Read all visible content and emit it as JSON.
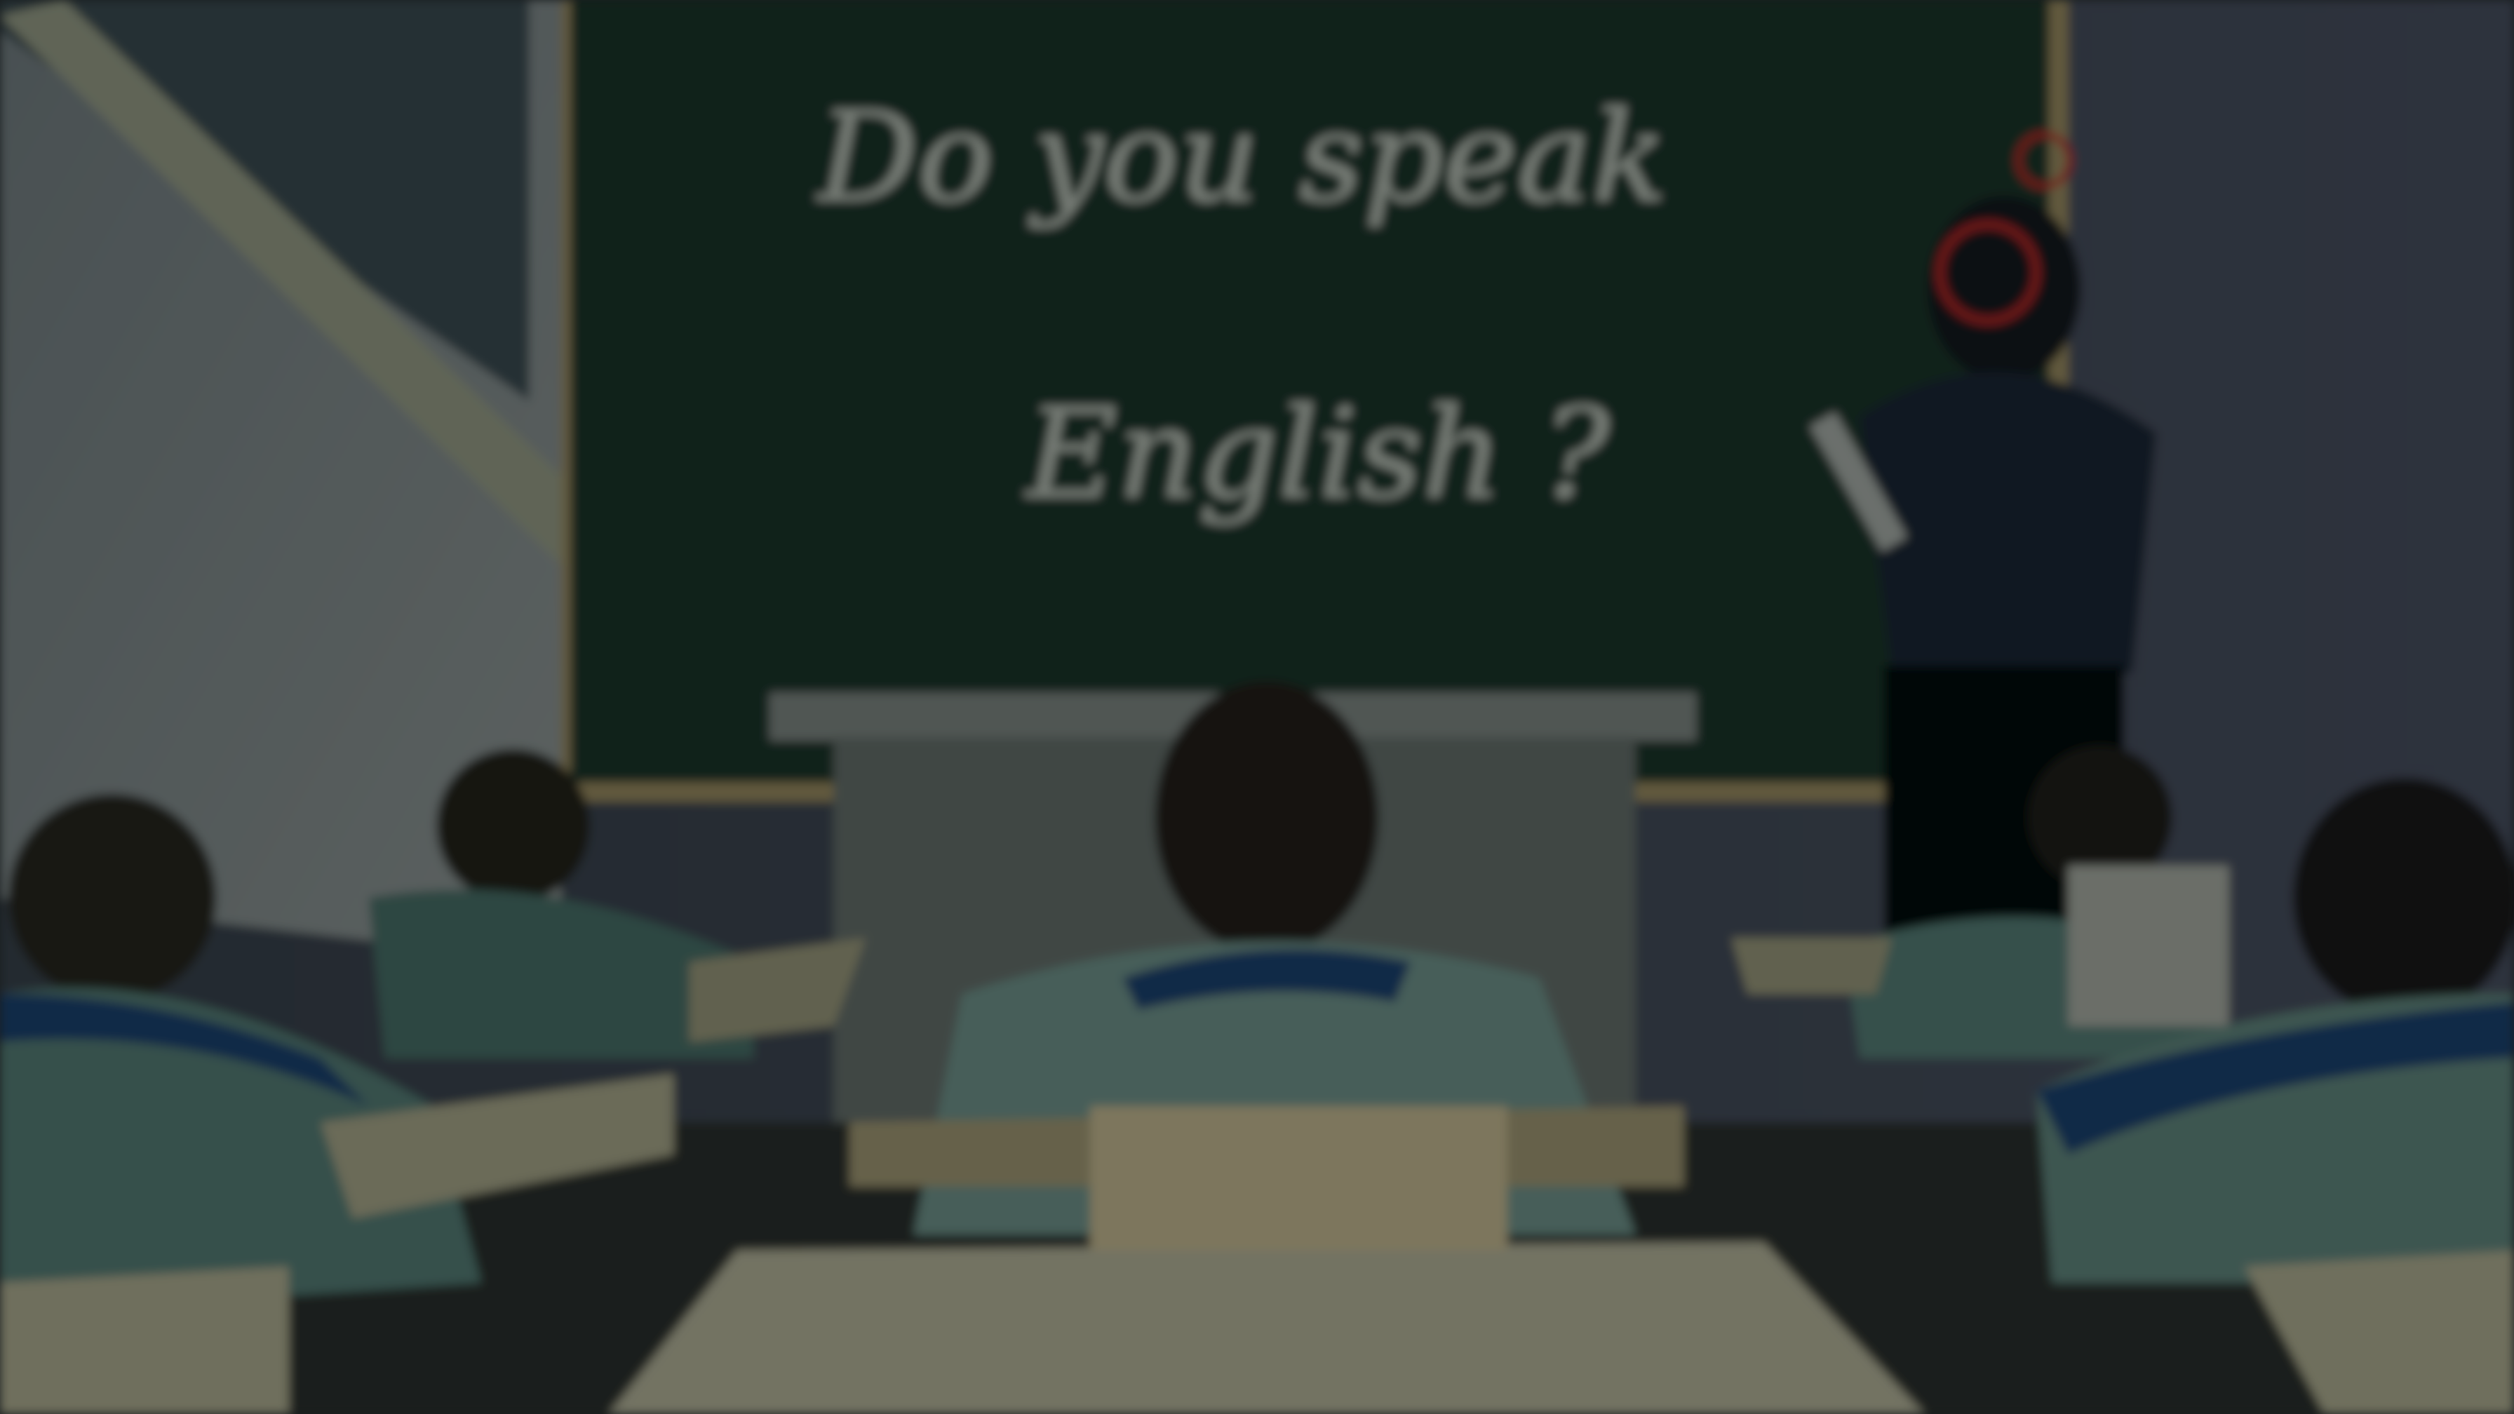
{
  "background_scene": {
    "chalkboard_line1": "Do you speak",
    "chalkboard_line2": "English ?"
  },
  "colors": {
    "chalkboard": "#1f3a2e",
    "wall": "#3a4750",
    "uniform": "#5d8a82",
    "uniform_trim": "#1f4a7a",
    "desk": "#b8b898",
    "overlay": "#000000"
  }
}
